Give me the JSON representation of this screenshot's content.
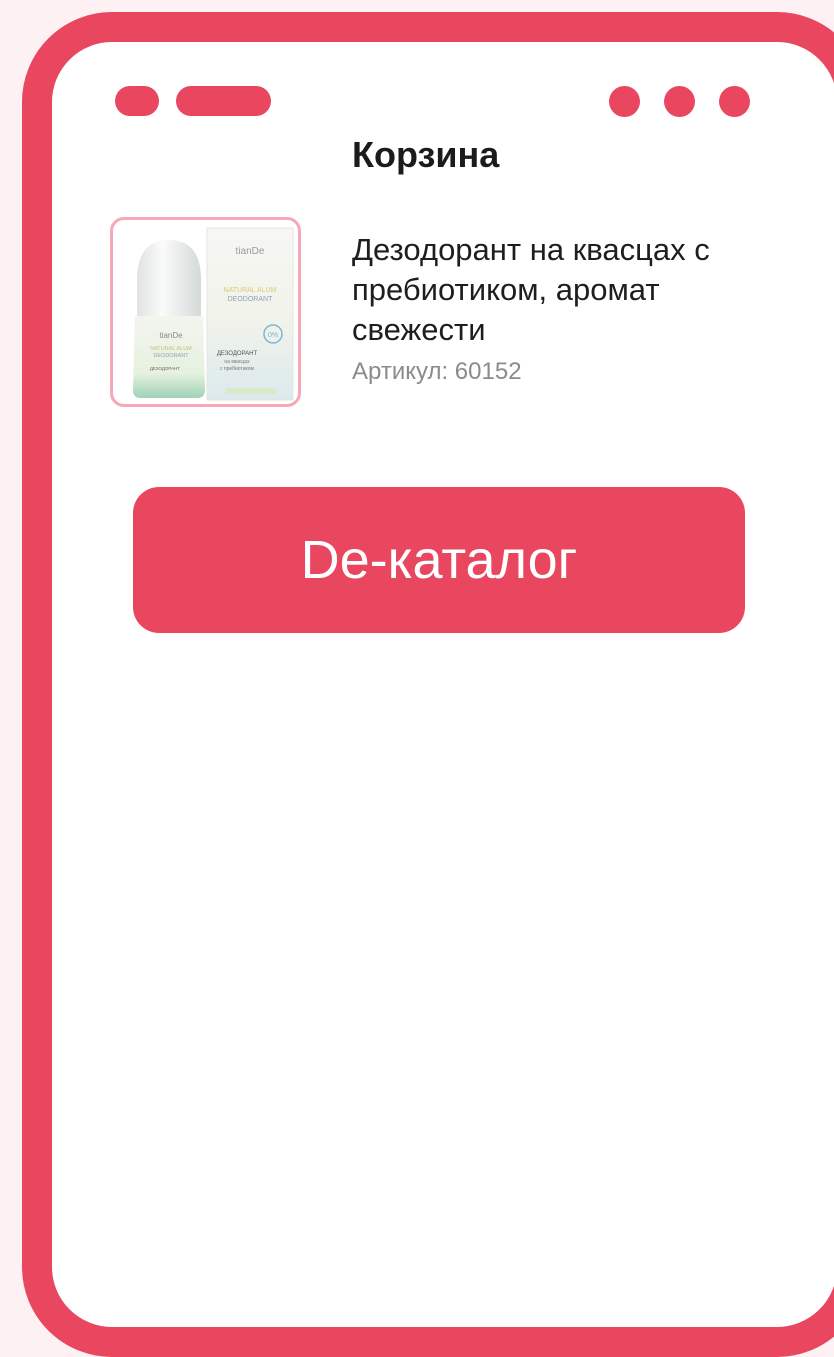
{
  "colors": {
    "accent": "#e9475f",
    "thumb_border": "#f4a9b6",
    "background": "#fdf1f3"
  },
  "cart": {
    "title": "Корзина"
  },
  "product": {
    "name": "Дезодорант на квасцах с пребиотиком, аромат свежести",
    "sku": "Артикул: 60152",
    "image": {
      "brand": "tianDe",
      "line_1": "NATURAL ALUM",
      "line_2": "DEODORANT",
      "badge": "0%",
      "box_title": "ДЕЗОДОРАНТ",
      "box_sub_1": "на квасцах",
      "box_sub_2": "с пребиотиком"
    }
  },
  "actions": {
    "catalog_label": "De-каталог"
  }
}
